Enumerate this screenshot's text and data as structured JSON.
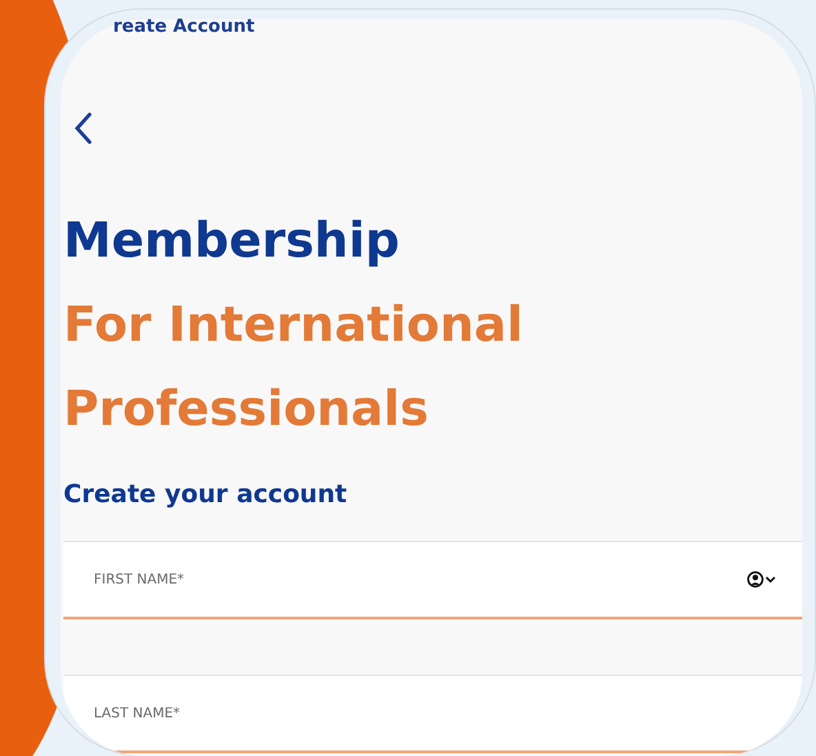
{
  "header": {
    "title": "reate Account"
  },
  "heading": {
    "line_1": "Membership",
    "line_2": "For International",
    "line_3": "Professionals"
  },
  "subheading": "Create your account",
  "fields": [
    {
      "placeholder": "FIRST NAME*",
      "kind": "contact"
    },
    {
      "placeholder": "LAST NAME*",
      "kind": "plain"
    }
  ]
}
